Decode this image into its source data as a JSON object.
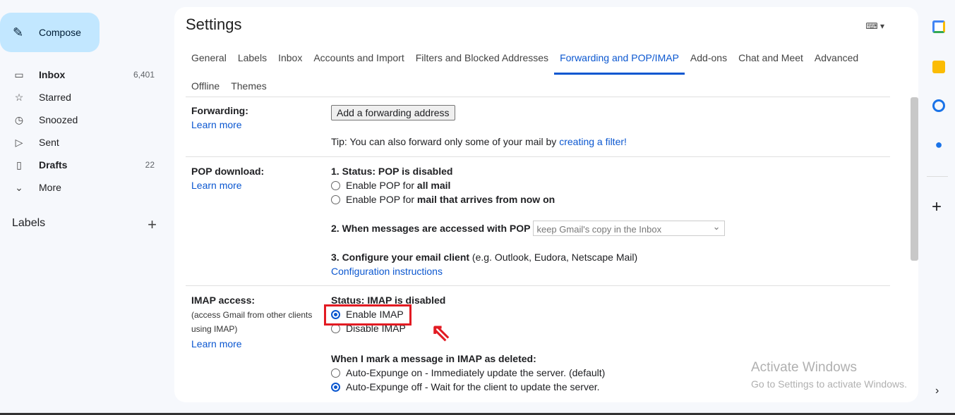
{
  "sidebar": {
    "compose": "Compose",
    "items": [
      {
        "icon": "inbox-icon",
        "label": "Inbox",
        "count": "6,401",
        "bold": true
      },
      {
        "icon": "star-icon",
        "label": "Starred",
        "count": ""
      },
      {
        "icon": "clock-icon",
        "label": "Snoozed",
        "count": ""
      },
      {
        "icon": "send-icon",
        "label": "Sent",
        "count": ""
      },
      {
        "icon": "draft-icon",
        "label": "Drafts",
        "count": "22",
        "bold": true
      },
      {
        "icon": "chevron-down-icon",
        "label": "More",
        "count": ""
      }
    ],
    "labels": "Labels"
  },
  "settings": {
    "title": "Settings",
    "tabs": [
      "General",
      "Labels",
      "Inbox",
      "Accounts and Import",
      "Filters and Blocked Addresses",
      "Forwarding and POP/IMAP",
      "Add-ons",
      "Chat and Meet",
      "Advanced",
      "Offline",
      "Themes"
    ],
    "active_tab": "Forwarding and POP/IMAP",
    "forwarding": {
      "label": "Forwarding:",
      "learn": "Learn more",
      "button": "Add a forwarding address",
      "tip": "Tip: You can also forward only some of your mail by ",
      "tip_link": "creating a filter!"
    },
    "pop": {
      "label": "POP download:",
      "learn": "Learn more",
      "status": "1. Status: POP is disabled",
      "opt1a": "Enable POP for ",
      "opt1b": "all mail",
      "opt2a": "Enable POP for ",
      "opt2b": "mail that arrives from now on",
      "q2": "2. When messages are accessed with POP",
      "q2_value": "keep Gmail's copy in the Inbox",
      "q3": "3. Configure your email client",
      "q3_hint": " (e.g. Outlook, Eudora, Netscape Mail)",
      "config_link": "Configuration instructions"
    },
    "imap": {
      "label": "IMAP access:",
      "sub1": "(access Gmail from other clients",
      "sub2": "using IMAP)",
      "learn": "Learn more",
      "status": "Status: IMAP is disabled",
      "enable": "Enable IMAP",
      "disable": "Disable IMAP",
      "deleted_q": "When I mark a message in IMAP as deleted:",
      "exp_on": "Auto-Expunge on - Immediately update the server. (default)",
      "exp_off": "Auto-Expunge off - Wait for the client to update the server."
    }
  },
  "watermark": {
    "line1": "Activate Windows",
    "line2": "Go to Settings to activate Windows."
  },
  "colors": {
    "accent": "#0b57d0",
    "highlight": "#e21b23",
    "compose_bg": "#c2e7ff"
  }
}
